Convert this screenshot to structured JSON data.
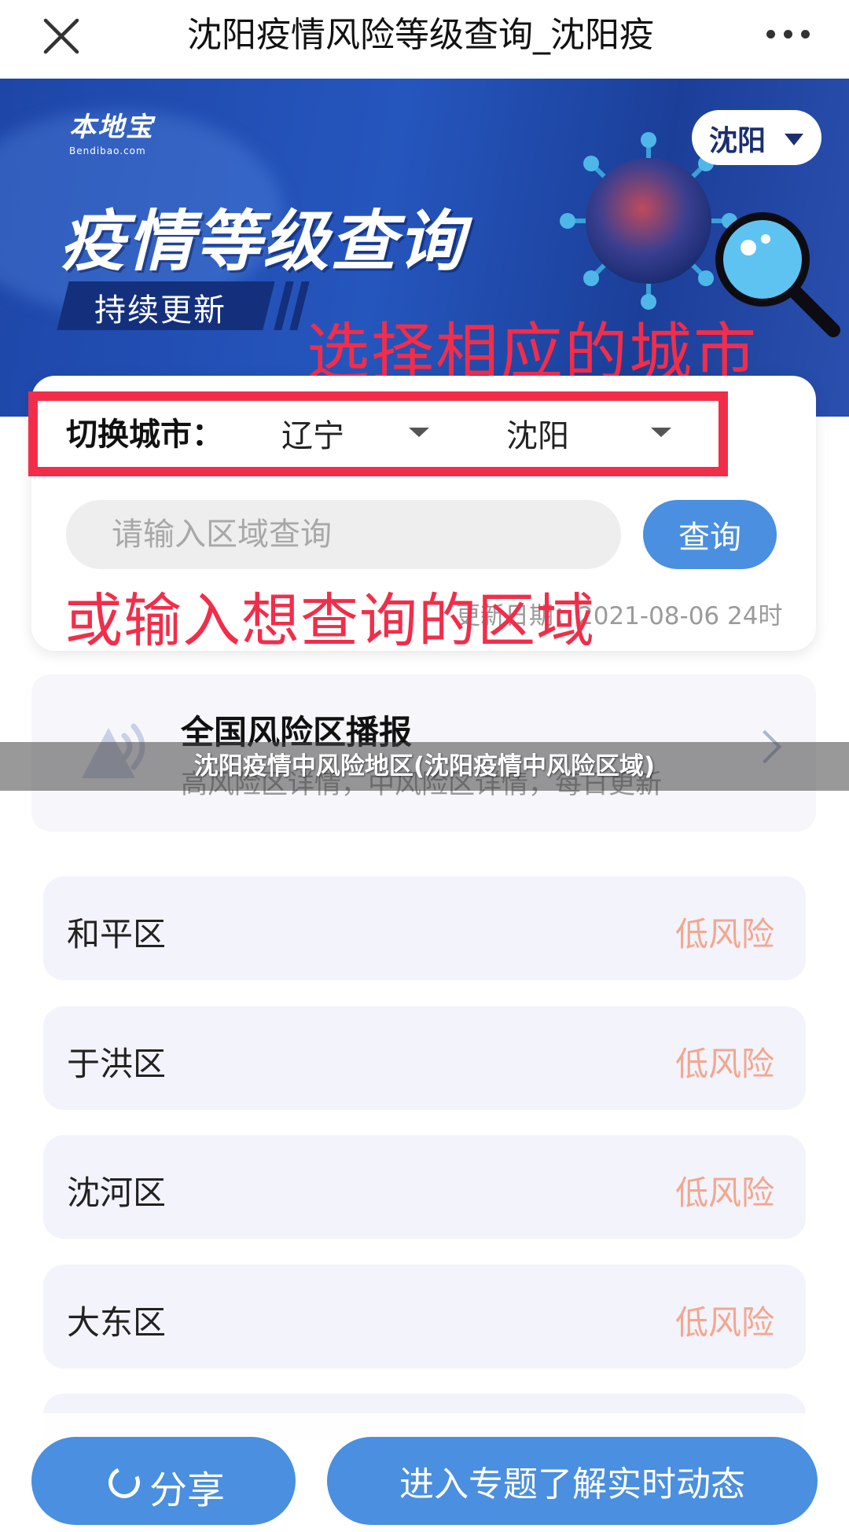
{
  "header": {
    "title": "沈阳疫情风险等级查询_沈阳疫"
  },
  "banner": {
    "logo_cn": "本地宝",
    "logo_en": "Bendibao.com",
    "heading": "疫情等级查询",
    "subheading": "持续更新",
    "city_pill": "沈阳",
    "annotation": "选择相应的城市"
  },
  "search_card": {
    "switch_label": "切换城市：",
    "province": "辽宁",
    "city": "沈阳",
    "search_placeholder": "请输入区域查询",
    "search_button": "查询",
    "update_time": "更新日期：2021-08-06 24时",
    "annotation": "或输入想查询的区域"
  },
  "broadcast": {
    "title": "全国风险区播报",
    "subtitle": "高风险区详情，中风险区详情，每日更新"
  },
  "caption": "沈阳疫情中风险地区(沈阳疫情中风险区域)",
  "districts": [
    {
      "name": "和平区",
      "risk": "低风险"
    },
    {
      "name": "于洪区",
      "risk": "低风险"
    },
    {
      "name": "沈河区",
      "risk": "低风险"
    },
    {
      "name": "大东区",
      "risk": "低风险"
    }
  ],
  "footer": {
    "share_label": "分享",
    "enter_label": "进入专题了解实时动态"
  },
  "colors": {
    "primary": "#4a8fe0",
    "annotation_red": "#f22d4a",
    "low_risk": "#f3a78e",
    "banner": "#2556bd"
  }
}
